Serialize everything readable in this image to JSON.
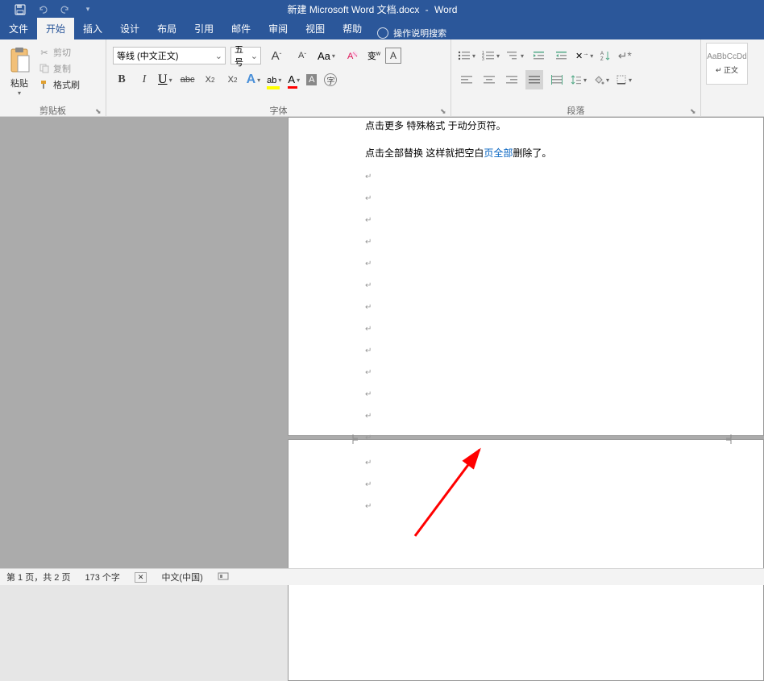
{
  "titlebar": {
    "doc_title": "新建 Microsoft Word 文档.docx",
    "separator": "-",
    "app_name": "Word"
  },
  "menus": {
    "file": "文件",
    "home": "开始",
    "insert": "插入",
    "design": "设计",
    "layout": "布局",
    "references": "引用",
    "mail": "邮件",
    "review": "审阅",
    "view": "视图",
    "help": "帮助",
    "tell_me": "操作说明搜索"
  },
  "ribbon": {
    "clipboard": {
      "label": "剪贴板",
      "paste": "粘贴",
      "cut": "剪切",
      "copy": "复制",
      "format_painter": "格式刷"
    },
    "font": {
      "label": "字体",
      "name": "等线 (中文正文)",
      "size": "五号"
    },
    "paragraph": {
      "label": "段落"
    },
    "styles": {
      "preview": "AaBbCcDd",
      "name": "↵ 正文"
    }
  },
  "document": {
    "line1": "点击更多 特殊格式 于动分页符。",
    "line2_a": "点击全部替换  这样就把空白",
    "line2_link": "页全部",
    "line2_b": "删除了。"
  },
  "statusbar": {
    "page": "第 1 页，共 2 页",
    "words": "173 个字",
    "lang": "中文(中国)"
  }
}
